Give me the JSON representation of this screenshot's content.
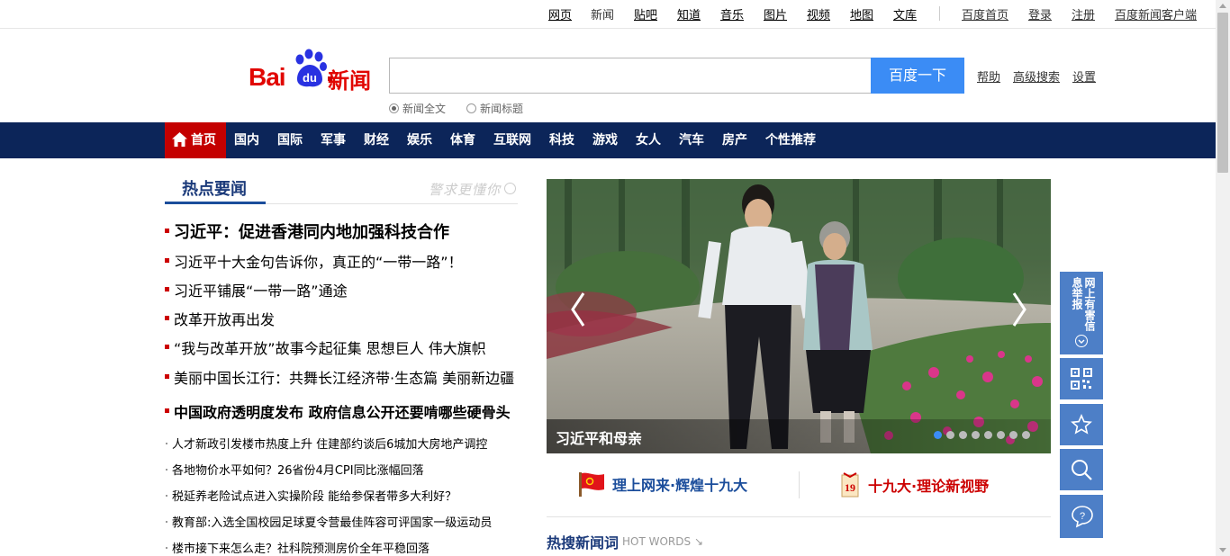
{
  "topnav": {
    "items": [
      "网页",
      "新闻",
      "贴吧",
      "知道",
      "音乐",
      "图片",
      "视频",
      "地图",
      "文库"
    ],
    "right": [
      "百度首页",
      "登录",
      "注册",
      "百度新闻客户端"
    ]
  },
  "logo": {
    "bai": "Bai",
    "du": "du",
    "news": "新闻"
  },
  "search": {
    "button": "百度一下",
    "value": "",
    "links": [
      "帮助",
      "高级搜索",
      "设置"
    ],
    "options": [
      "新闻全文",
      "新闻标题"
    ]
  },
  "mainnav": {
    "home": "首页",
    "items": [
      "国内",
      "国际",
      "军事",
      "财经",
      "娱乐",
      "体育",
      "互联网",
      "科技",
      "游戏",
      "女人",
      "汽车",
      "房产",
      "个性推荐"
    ]
  },
  "hot": {
    "title": "热点要闻",
    "slogan": "警求更懂你",
    "headlines": [
      "习近平：促进香港同内地加强科技合作",
      "习近平十大金句告诉你，真正的“一带一路”！",
      "习近平铺展“一带一路”通途",
      "改革开放再出发",
      "“我与改革开放”故事今起征集 思想巨人 伟大旗帜",
      "美丽中国长江行：共舞长江经济带·生态篇 美丽新边疆",
      "中国政府透明度发布 政府信息公开还要啃哪些硬骨头"
    ],
    "small": [
      "人才新政引发楼市热度上升 住建部约谈后6城加大房地产调控",
      "各地物价水平如何？26省份4月CPI同比涨幅回落",
      "税延养老险试点进入实操阶段 能给参保者带多大利好？",
      "教育部:入选全国校园足球夏令营最佳阵容可评国家一级运动员",
      "楼市接下来怎么走？社科院预测房价全年平稳回落"
    ]
  },
  "slide": {
    "caption": "习近平和母亲",
    "total_dots": 8,
    "active_dot": 1
  },
  "banners": [
    "理上网来·辉煌十九大",
    "十九大·理论新视野"
  ],
  "hotsearch": {
    "title": "热搜新闻词",
    "sub": "HOT WORDS"
  },
  "sidetools": {
    "report": "网上有害信息举报"
  },
  "colors": {
    "nav_bg": "#0c2559",
    "home_bg": "#c40000",
    "search_btn": "#3b8cf5",
    "tool_bg": "#4d7fc7"
  }
}
